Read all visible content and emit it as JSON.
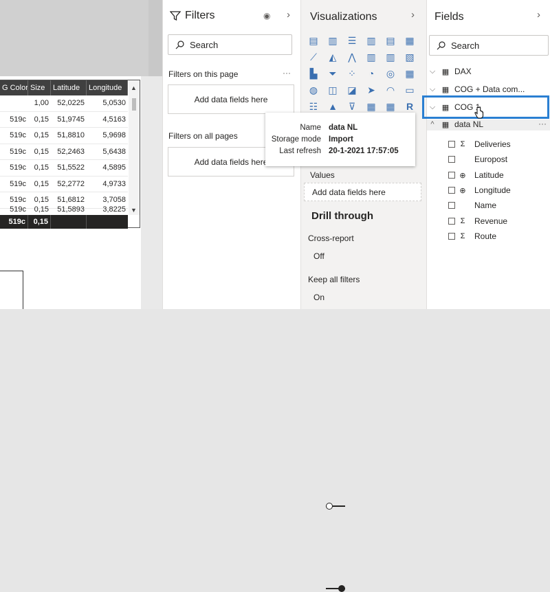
{
  "canvas": {
    "table": {
      "columns": [
        "G Color",
        "Size",
        "Latitude",
        "Longitude"
      ],
      "rows": [
        [
          "",
          "1,00",
          "52,0225",
          "5,0530"
        ],
        [
          "519c",
          "0,15",
          "51,9745",
          "4,5163"
        ],
        [
          "519c",
          "0,15",
          "51,8810",
          "5,9698"
        ],
        [
          "519c",
          "0,15",
          "52,2463",
          "5,6438"
        ],
        [
          "519c",
          "0,15",
          "51,5522",
          "4,5895"
        ],
        [
          "519c",
          "0,15",
          "52,2772",
          "4,9733"
        ],
        [
          "519c",
          "0,15",
          "51,6812",
          "3,7058"
        ],
        [
          "519c",
          "0,15",
          "51,5893",
          "3,8225"
        ]
      ],
      "total": [
        "519c",
        "0,15",
        "",
        ""
      ]
    }
  },
  "filters": {
    "title": "Filters",
    "search_placeholder": "Search",
    "section_page": "Filters on this page",
    "section_all": "Filters on all pages",
    "dropzone_page": "Add data fields here",
    "dropzone_all": "Add data fields here",
    "more": "···"
  },
  "visualizations": {
    "title": "Visualizations",
    "icons": [
      "stacked-bar-chart-icon",
      "stacked-column-chart-icon",
      "clustered-bar-chart-icon",
      "clustered-column-chart-icon",
      "100-stacked-bar-chart-icon",
      "100-stacked-column-chart-icon",
      "line-chart-icon",
      "area-chart-icon",
      "stacked-area-chart-icon",
      "line-column-chart-icon",
      "line-clustered-column-chart-icon",
      "ribbon-chart-icon",
      "waterfall-chart-icon",
      "funnel-chart-icon",
      "scatter-chart-icon",
      "pie-chart-icon",
      "donut-chart-icon",
      "treemap-icon",
      "map-icon",
      "filled-map-icon",
      "shape-map-icon",
      "azure-map-icon",
      "gauge-icon",
      "card-icon",
      "multi-row-card-icon",
      "kpi-icon",
      "slicer-icon",
      "table-icon",
      "matrix-icon",
      "r-visual-icon"
    ],
    "values_label": "Values",
    "values_dropzone": "Add data fields here",
    "drill_through": "Drill through",
    "cross_report": "Cross-report",
    "cross_report_state": "Off",
    "keep_all_filters": "Keep all filters",
    "keep_all_filters_state": "On"
  },
  "tooltip": {
    "name_label": "Name",
    "name_value": "data NL",
    "storage_label": "Storage mode",
    "storage_value": "Import",
    "refresh_label": "Last refresh",
    "refresh_value": "20-1-2021 17:57:05"
  },
  "fields": {
    "title": "Fields",
    "search_placeholder": "Search",
    "tables": [
      {
        "name": "DAX",
        "type": "calculator"
      },
      {
        "name": "COG + Data com...",
        "type": "table"
      },
      {
        "name": "COG 1",
        "type": "table"
      },
      {
        "name": "data NL",
        "type": "table"
      }
    ],
    "data_nl_fields": [
      {
        "name": "Deliveries",
        "type": "sigma"
      },
      {
        "name": "Europost",
        "type": "none"
      },
      {
        "name": "Latitude",
        "type": "globe"
      },
      {
        "name": "Longitude",
        "type": "globe"
      },
      {
        "name": "Name",
        "type": "none"
      },
      {
        "name": "Revenue",
        "type": "sigma"
      },
      {
        "name": "Route",
        "type": "sigma"
      }
    ],
    "more": "···"
  },
  "colors": {
    "accent": "#2a7fd2",
    "table_header": "#404040",
    "pane_bg": "#f3f2f1"
  }
}
